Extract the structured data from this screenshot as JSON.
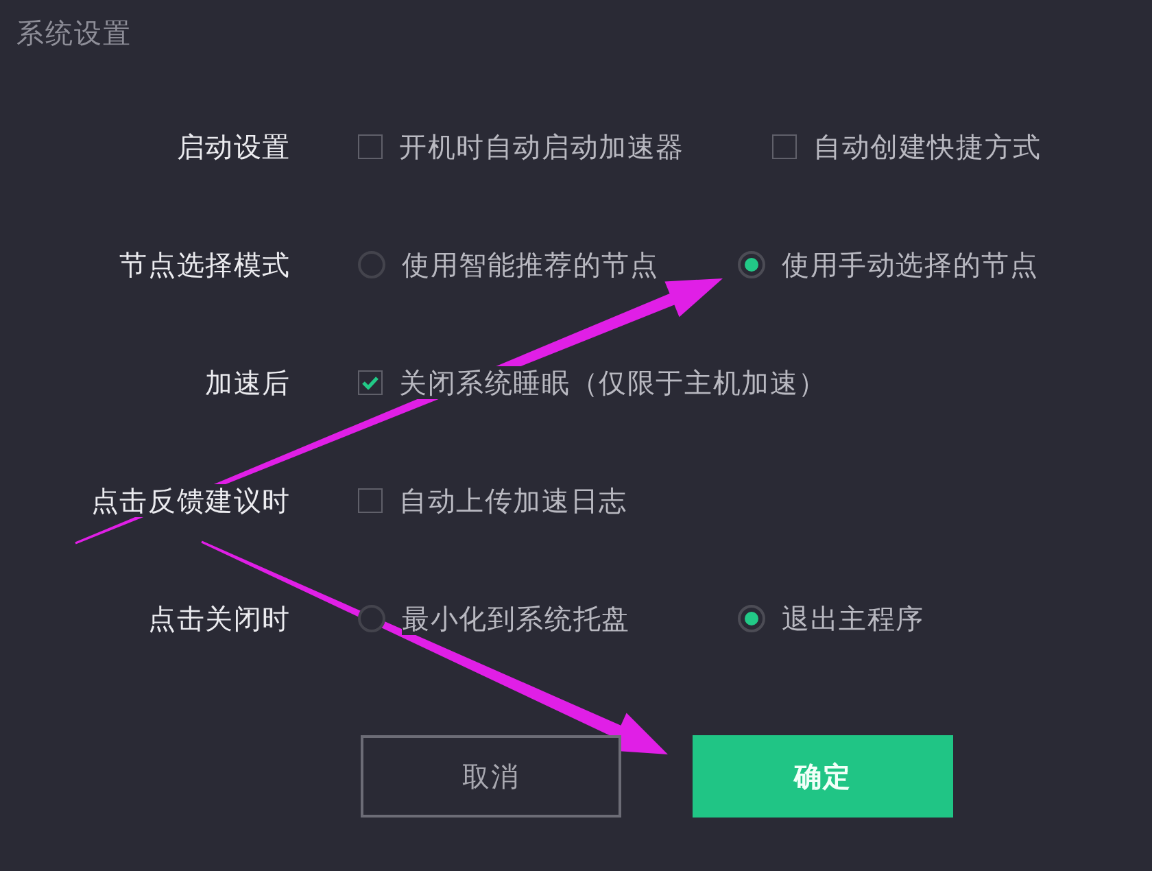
{
  "window": {
    "title": "系统设置"
  },
  "settings": [
    {
      "label": "启动设置",
      "kind": "checkbox",
      "options": [
        {
          "label": "开机时自动启动加速器",
          "checked": false
        },
        {
          "label": "自动创建快捷方式",
          "checked": false
        }
      ]
    },
    {
      "label": "节点选择模式",
      "kind": "radio",
      "options": [
        {
          "label": "使用智能推荐的节点",
          "selected": false
        },
        {
          "label": "使用手动选择的节点",
          "selected": true
        }
      ]
    },
    {
      "label": "加速后",
      "kind": "checkbox",
      "options": [
        {
          "label": "关闭系统睡眠（仅限于主机加速）",
          "checked": true
        }
      ]
    },
    {
      "label": "点击反馈建议时",
      "kind": "checkbox",
      "options": [
        {
          "label": "自动上传加速日志",
          "checked": false
        }
      ]
    },
    {
      "label": "点击关闭时",
      "kind": "radio",
      "options": [
        {
          "label": "最小化到系统托盘",
          "selected": false
        },
        {
          "label": "退出主程序",
          "selected": true
        }
      ]
    }
  ],
  "buttons": [
    {
      "label": "取消",
      "kind": "secondary"
    },
    {
      "label": "确定",
      "kind": "primary"
    }
  ]
}
